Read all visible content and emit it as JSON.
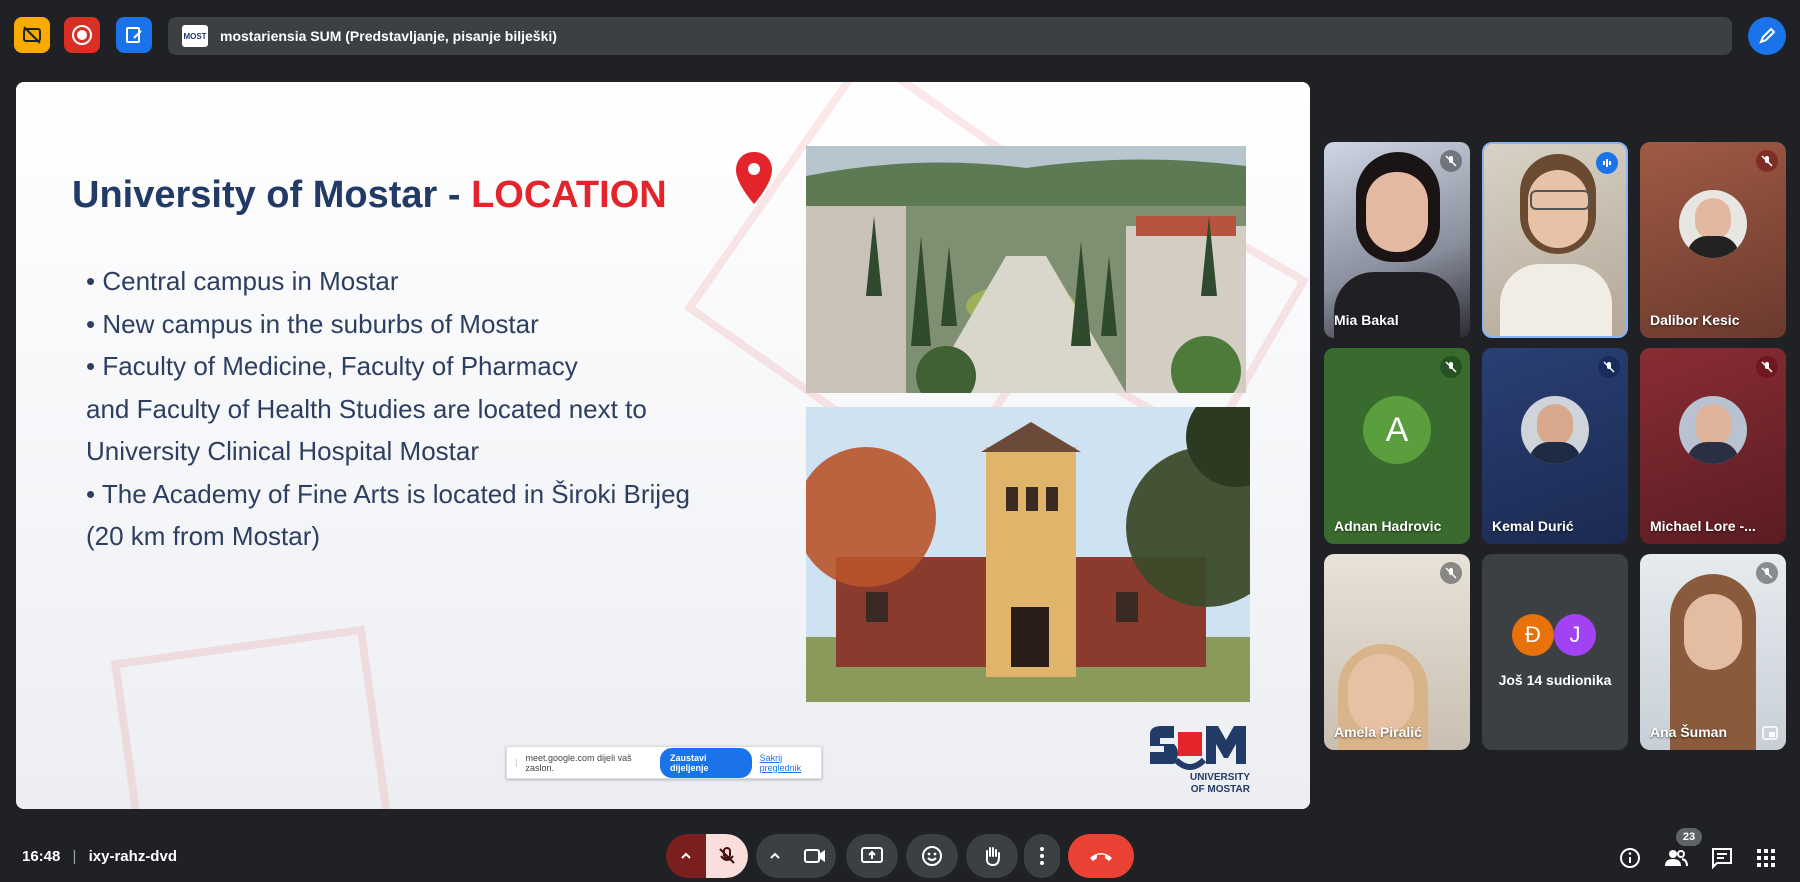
{
  "window": {
    "title": "mostariensia SUM (Predstavljanje, pisanje bilješki)",
    "logo_text": "MOST"
  },
  "slide": {
    "title_main": "University of Mostar -",
    "title_highlight": "LOCATION",
    "bullets": [
      "•  Central campus in Mostar",
      "•  New campus in the suburbs of Mostar",
      "•  Faculty of Medicine, Faculty of Pharmacy",
      "and Faculty of Health Studies are located  next to",
      "University Clinical Hospital Mostar",
      "•  The Academy of Fine Arts is located  in Široki Brijeg",
      "(20 km from Mostar)"
    ],
    "logo_text_1": "UNIVERSITY",
    "logo_text_2": "OF MOSTAR"
  },
  "share_popup": {
    "message": "meet.google.com dijeli vaš zaslon.",
    "stop_label": "Zaustavi dijeljenje",
    "hide_label": "Sakrij preglednik"
  },
  "participants": [
    {
      "name": "Mia Bakal",
      "muted": true
    },
    {
      "name": "",
      "muted": false,
      "speaking": true
    },
    {
      "name": "Dalibor Kesic",
      "muted": true
    },
    {
      "name": "Adnan Hadrovic",
      "initial": "A",
      "muted": true
    },
    {
      "name": "Kemal Durić",
      "muted": true
    },
    {
      "name": "Michael Lore -...",
      "muted": true
    },
    {
      "name": "Amela Piralić",
      "muted": true
    },
    {
      "name": "Još 14 sudionika",
      "initials": [
        "Đ",
        "J"
      ]
    },
    {
      "name": "Ana Šuman",
      "muted": true
    }
  ],
  "bottom": {
    "time": "16:48",
    "separator": "|",
    "meeting_code": "ixy-rahz-dvd",
    "participant_count": "23"
  },
  "colors": {
    "accent_blue": "#1a73e8",
    "end_call_red": "#ea4335",
    "title_navy": "#213a66",
    "title_red": "#e3242b"
  }
}
